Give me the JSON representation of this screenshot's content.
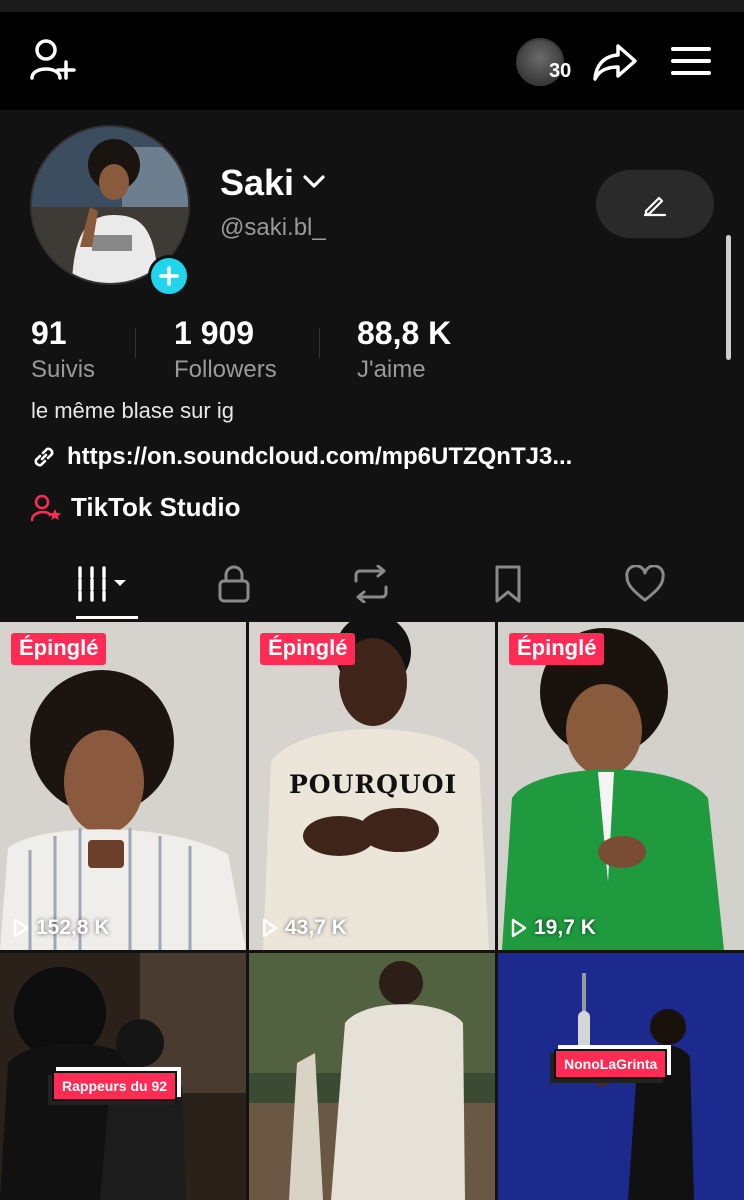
{
  "topbar": {
    "story_count": "30"
  },
  "profile": {
    "name": "Saki",
    "handle": "@saki.bl_",
    "stats": [
      {
        "value": "91",
        "label": "Suivis"
      },
      {
        "value": "1 909",
        "label": "Followers"
      },
      {
        "value": "88,8 K",
        "label": "J'aime"
      }
    ],
    "bio": "le même blase sur ig",
    "link": "https://on.soundcloud.com/mp6UTZQnTJ3...",
    "studio": "TikTok Studio"
  },
  "videos": [
    {
      "pinned": "Épinglé",
      "views": "152,8 K"
    },
    {
      "pinned": "Épinglé",
      "views": "43,7 K",
      "overlay": "POURQUOI"
    },
    {
      "pinned": "Épinglé",
      "views": "19,7 K"
    },
    {
      "sticker": "Rappeurs du 92"
    },
    {},
    {
      "sticker": "NonoLaGrinta"
    }
  ],
  "colors": {
    "accent": "#fe2c55",
    "badge": "#20d5ec",
    "background": "#121212"
  }
}
